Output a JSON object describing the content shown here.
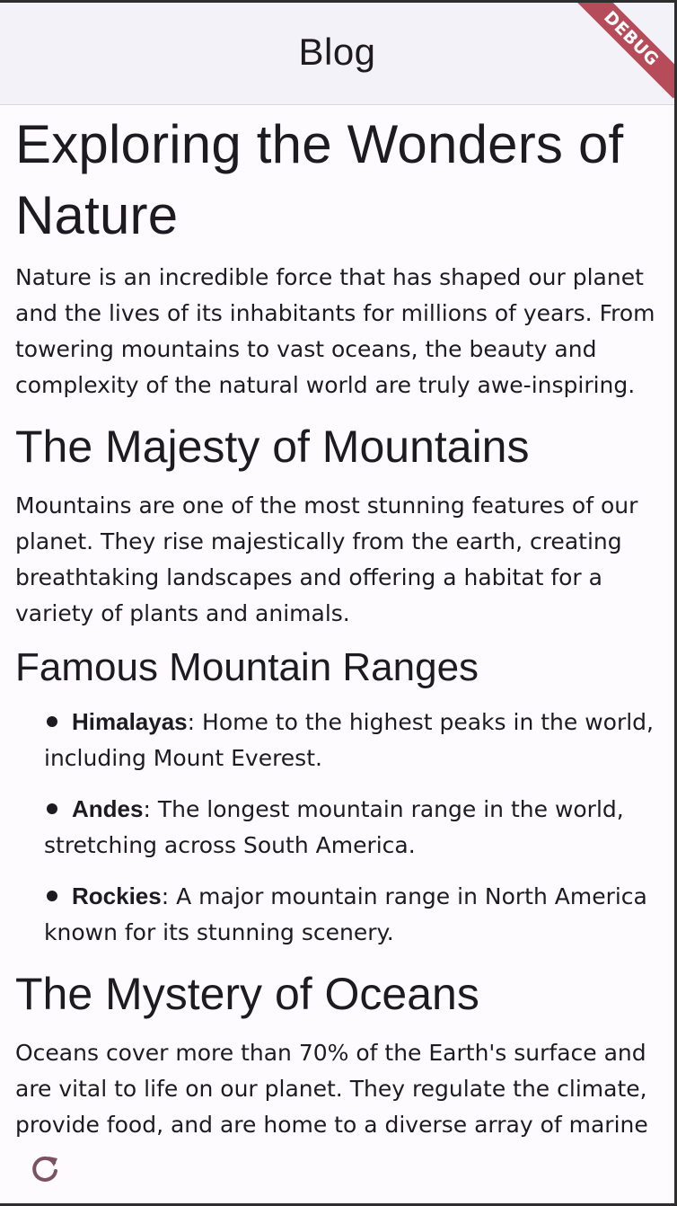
{
  "app_bar": {
    "title": "Blog",
    "debug_banner": "DEBUG"
  },
  "article": {
    "title": "Exploring the Wonders of Nature",
    "intro": "Nature is an incredible force that has shaped our planet and the lives of its inhabitants for millions of years. From towering mountains to vast oceans, the beauty and complexity of the natural world are truly awe-inspiring.",
    "section_mountains": {
      "heading": "The Majesty of Mountains",
      "body": "Mountains are one of the most stunning features of our planet. They rise majestically from the earth, creating breathtaking landscapes and offering a habitat for a variety of plants and animals."
    },
    "section_ranges": {
      "heading": "Famous Mountain Ranges",
      "items": [
        {
          "term": "Himalayas",
          "text": ": Home to the highest peaks in the world, including Mount Everest."
        },
        {
          "term": "Andes",
          "text": ": The longest mountain range in the world, stretching across South America."
        },
        {
          "term": "Rockies",
          "text": ": A major mountain range in North America known for its stunning scenery."
        }
      ]
    },
    "section_oceans": {
      "heading": "The Mystery of Oceans",
      "body": "Oceans cover more than 70% of the Earth's surface and are vital to life on our planet. They regulate the climate, provide food, and are home to a diverse array of marine"
    }
  },
  "icons": {
    "refresh": "refresh-icon"
  },
  "colors": {
    "app_bar_bg": "#f3f2f8",
    "page_bg": "#fefbff",
    "text": "#1d1b20",
    "debug_banner": "#b03a48",
    "refresh_icon": "#7d5260"
  }
}
